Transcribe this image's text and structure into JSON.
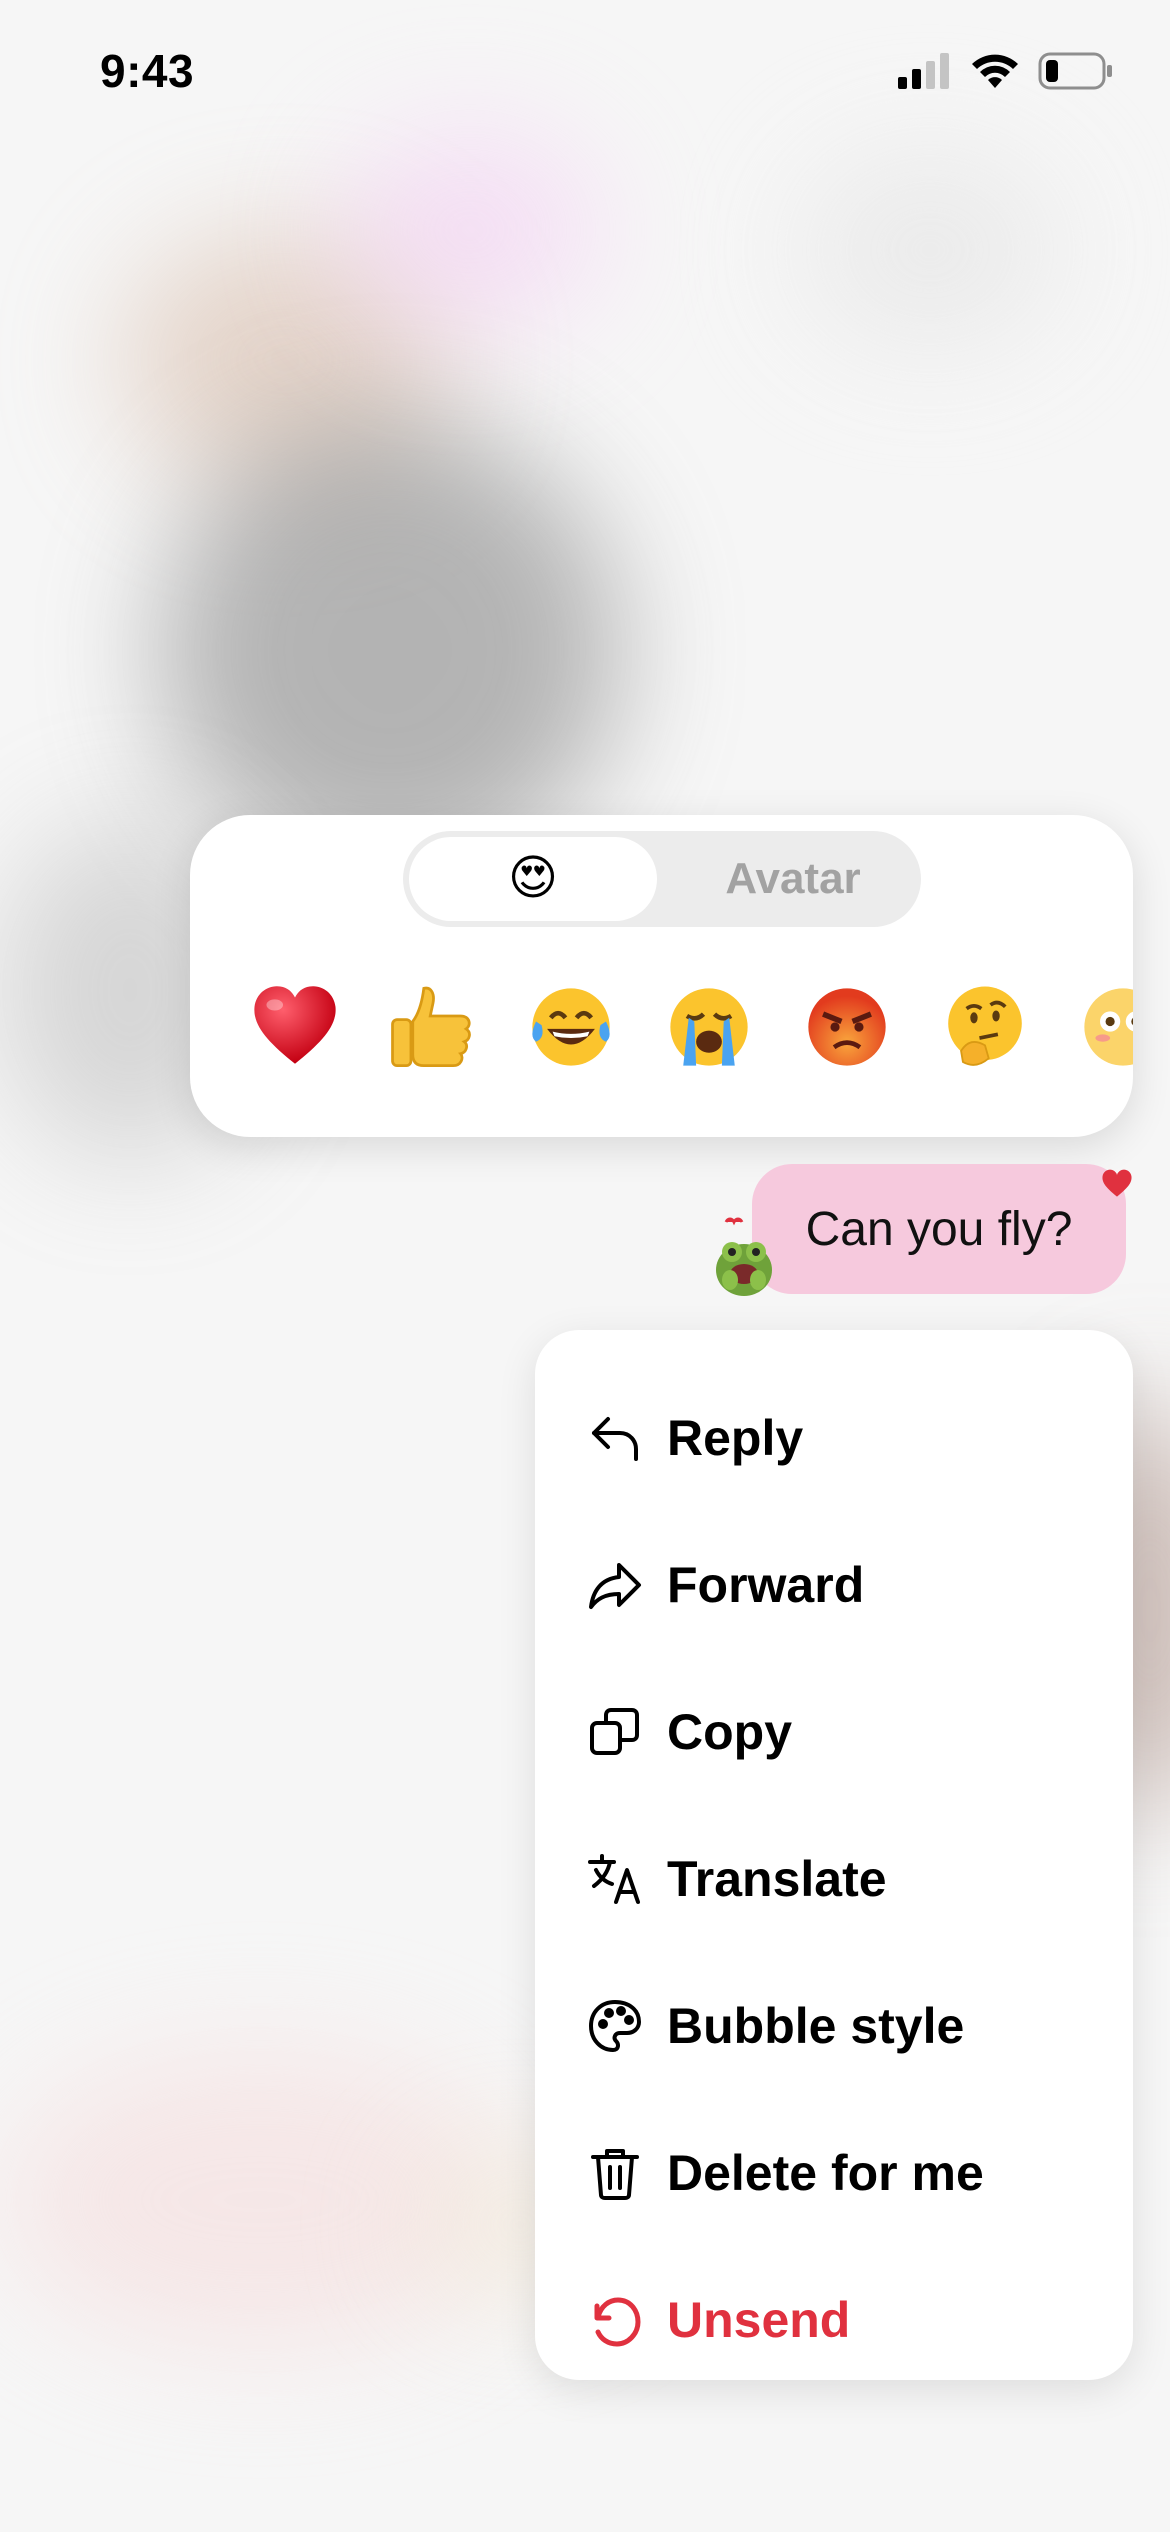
{
  "status_bar": {
    "time": "9:43"
  },
  "reaction_picker": {
    "tabs": [
      {
        "label": "😍",
        "selected": true
      },
      {
        "label": "Avatar",
        "selected": false
      }
    ],
    "emojis": [
      "❤️",
      "👍",
      "😂",
      "😭",
      "😡",
      "🤔",
      "😳"
    ]
  },
  "message": {
    "text": "Can you fly?"
  },
  "menu": {
    "items": [
      {
        "label": "Reply",
        "icon": "reply-icon"
      },
      {
        "label": "Forward",
        "icon": "forward-icon"
      },
      {
        "label": "Copy",
        "icon": "copy-icon"
      },
      {
        "label": "Translate",
        "icon": "translate-icon"
      },
      {
        "label": "Bubble style",
        "icon": "palette-icon"
      },
      {
        "label": "Delete for me",
        "icon": "trash-icon"
      },
      {
        "label": "Unsend",
        "icon": "undo-icon",
        "color": "#e0313f"
      }
    ]
  },
  "colors": {
    "bubble": "#f6c9dd",
    "danger": "#e0313f",
    "segment_bg": "#ececec"
  }
}
